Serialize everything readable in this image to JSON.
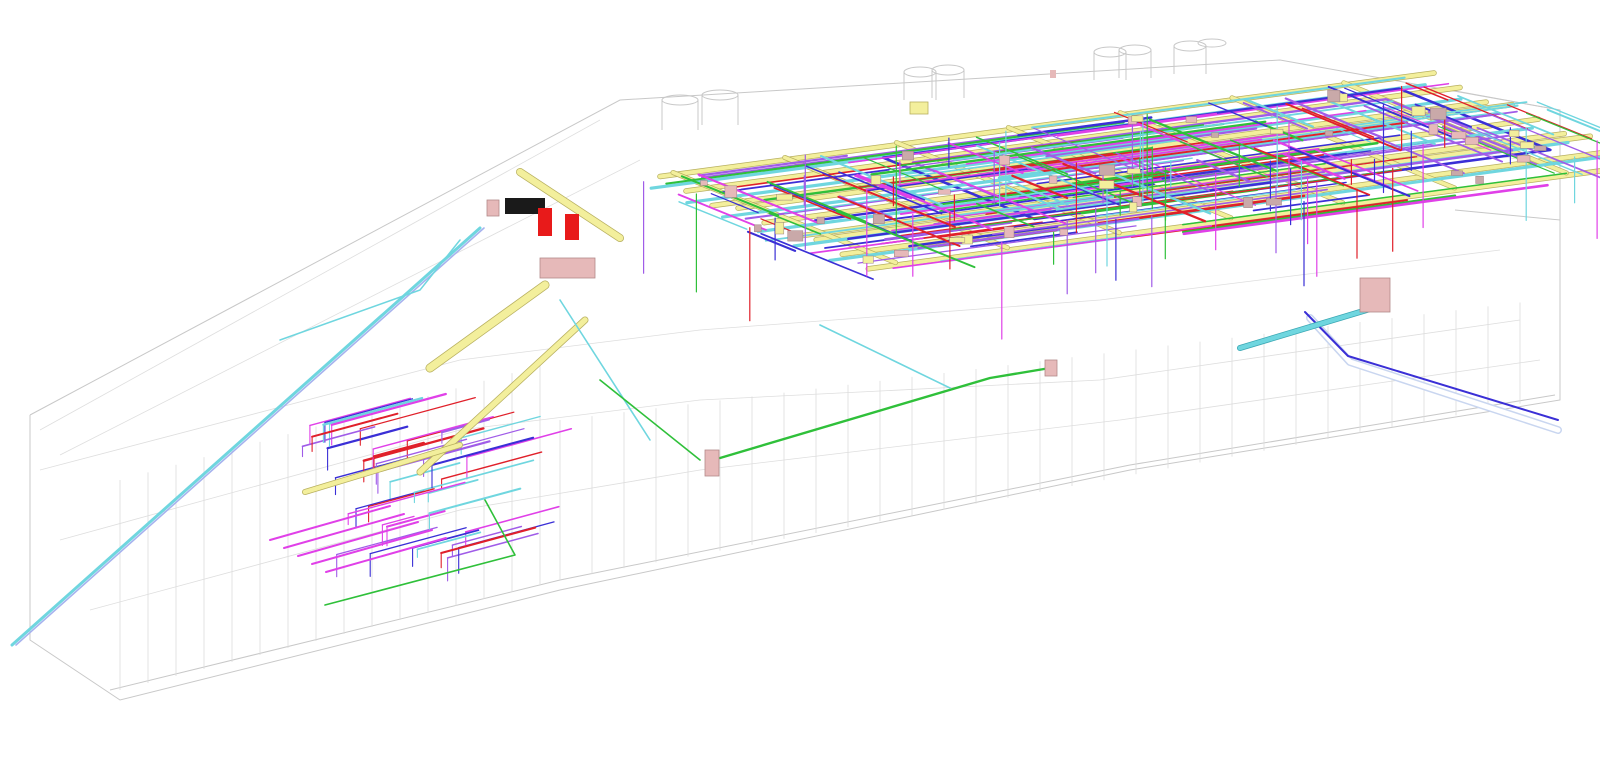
{
  "model": {
    "systems": [
      {
        "id": "supply-air-duct",
        "color": "#f3ef9c"
      },
      {
        "id": "exhaust-duct",
        "color": "#6fd6df"
      },
      {
        "id": "hot-water-pipe",
        "color": "#e0202a"
      },
      {
        "id": "chilled-water-pipe",
        "color": "#3a2fd6"
      },
      {
        "id": "plumbing-pipe",
        "color": "#a05ce8"
      },
      {
        "id": "drainage-pipe",
        "color": "#2fc03a"
      },
      {
        "id": "fire-pipe",
        "color": "#e040e8"
      },
      {
        "id": "equipment",
        "color": "#e6b9b9"
      },
      {
        "id": "fire-pump",
        "color": "#e81a1a"
      },
      {
        "id": "transformer",
        "color": "#1a1a1a"
      }
    ],
    "background_color": "#ffffff"
  }
}
